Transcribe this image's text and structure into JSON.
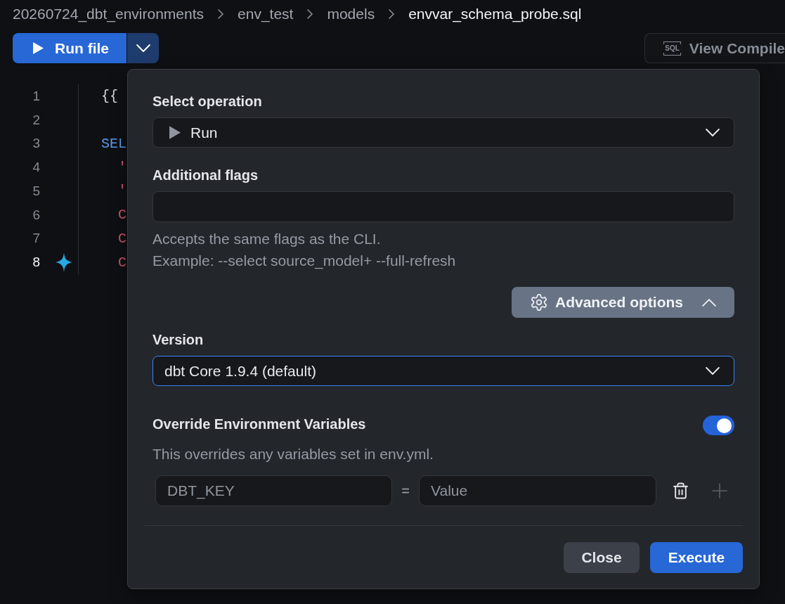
{
  "breadcrumb": [
    {
      "label": "20260724_dbt_environments",
      "current": false
    },
    {
      "label": "env_test",
      "current": false
    },
    {
      "label": "models",
      "current": false
    },
    {
      "label": "envvar_schema_probe.sql",
      "current": true
    }
  ],
  "toolbar": {
    "run_button": {
      "label": "Run file"
    },
    "view_compiled_button": {
      "icon_text": "SQL",
      "label": "View Compile"
    }
  },
  "editor": {
    "lines": [
      {
        "number": "1",
        "code": "{{",
        "kind": "template",
        "current": false,
        "sparkle": false
      },
      {
        "number": "2",
        "kind": "blank",
        "current": false,
        "sparkle": false
      },
      {
        "number": "3",
        "code": "SEL",
        "kind": "keyword",
        "current": false,
        "sparkle": false
      },
      {
        "number": "4",
        "code": "  '",
        "kind": "string",
        "current": false,
        "sparkle": false
      },
      {
        "number": "5",
        "code": "  '",
        "kind": "string",
        "current": false,
        "sparkle": false
      },
      {
        "number": "6",
        "code": "  C",
        "kind": "function",
        "current": false,
        "sparkle": false
      },
      {
        "number": "7",
        "code": "  C",
        "kind": "function",
        "current": false,
        "sparkle": false
      },
      {
        "number": "8",
        "code": "  C",
        "kind": "function",
        "current": true,
        "sparkle": true
      }
    ]
  },
  "run_panel": {
    "operation": {
      "label": "Select operation",
      "value": "Run"
    },
    "flags": {
      "label": "Additional flags",
      "help": [
        "Accepts the same flags as the CLI.",
        "Example: --select source_model+ --full-refresh"
      ]
    },
    "advanced_button": {
      "label": "Advanced options",
      "expanded": true
    },
    "version": {
      "label": "Version",
      "value": "dbt Core 1.9.4 (default)",
      "focused": true
    },
    "env_override": {
      "label": "Override Environment Variables",
      "on": true,
      "description": "This overrides any variables set in env.yml.",
      "rows": [
        {
          "key_placeholder": "DBT_KEY",
          "separator": "=",
          "value_placeholder": "Value"
        }
      ]
    },
    "buttons": [
      {
        "label": "Close",
        "kind": "secondary"
      },
      {
        "label": "Execute",
        "kind": "primary"
      }
    ]
  }
}
